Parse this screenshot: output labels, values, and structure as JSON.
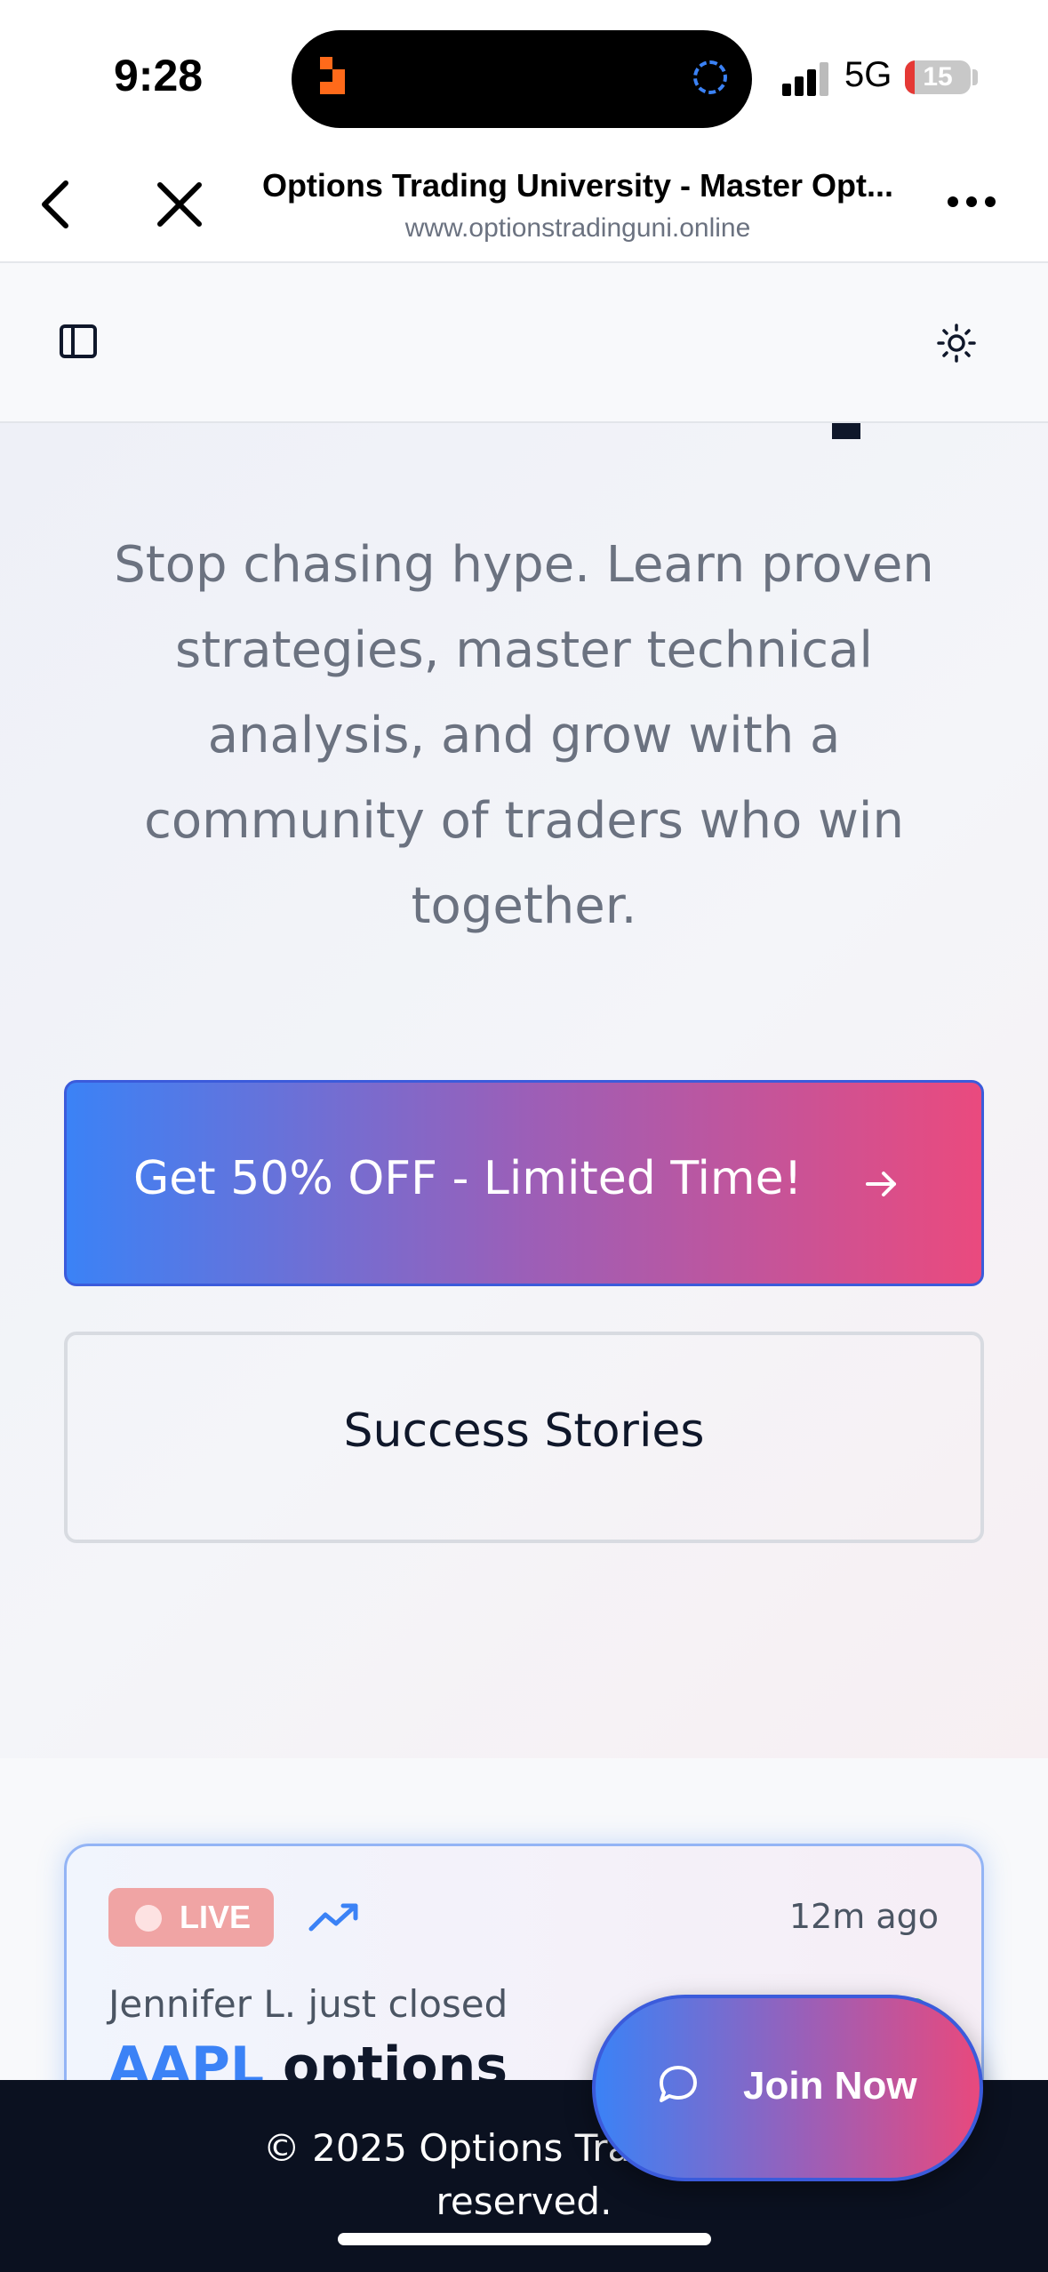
{
  "status_bar": {
    "time": "9:28",
    "network": "5G",
    "battery": "15",
    "battery_level": 0.15
  },
  "browser": {
    "title": "Options Trading University - Master Opt...",
    "url": "www.optionstradinguni.online"
  },
  "hero": {
    "subtitle": "Stop chasing hype. Learn proven strategies, master technical analysis, and grow with a community of traders who win together.",
    "primary_cta": "Get 50% OFF - Limited Time!",
    "secondary_cta": "Success Stories"
  },
  "activity": {
    "badge": "LIVE",
    "time_ago": "12m ago",
    "text": "Jennifer L. just closed",
    "ticker": "AAPL",
    "ticker_suffix": " options"
  },
  "join_button": {
    "label": "Join Now"
  },
  "footer": {
    "line1": "© 2025 Options Trading Uni",
    "line2": "reserved."
  },
  "colors": {
    "accent_blue": "#3b82f6",
    "accent_pink": "#ea4a7e",
    "footer_bg": "#0b1120",
    "live_badge": "#f0a4a4"
  },
  "icons": [
    "back-icon",
    "close-icon",
    "more-icon",
    "sidebar-icon",
    "theme-icon",
    "arrow-right-icon",
    "trend-icon",
    "chat-icon"
  ]
}
